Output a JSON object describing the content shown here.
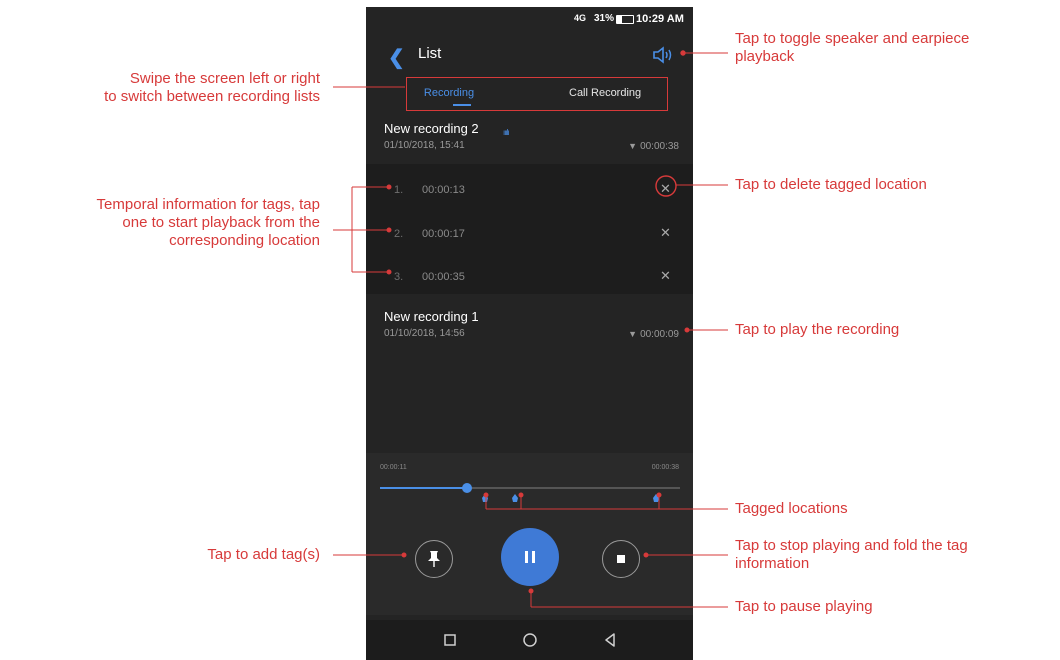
{
  "status_bar": {
    "network": "4G",
    "battery": "31%",
    "time": "10:29 AM"
  },
  "header": {
    "title": "List"
  },
  "tabs": [
    {
      "label": "Recording"
    },
    {
      "label": "Call Recording"
    }
  ],
  "recordings": [
    {
      "title": "New recording 2",
      "date": "01/10/2018, 15:41",
      "duration": "00:00:38",
      "tags": [
        {
          "num": "1.",
          "time": "00:00:13"
        },
        {
          "num": "2.",
          "time": "00:00:17"
        },
        {
          "num": "3.",
          "time": "00:00:35"
        }
      ]
    },
    {
      "title": "New recording 1",
      "date": "01/10/2018, 14:56",
      "duration": "00:00:09"
    }
  ],
  "player": {
    "elapsed": "00:00:11",
    "total": "00:00:38",
    "progress": 0.29,
    "tag_positions": [
      0.35,
      0.45,
      0.92
    ]
  },
  "annotations": {
    "swipe": [
      "Swipe the screen left or right",
      "to switch between recording lists"
    ],
    "toggle": [
      "Tap to toggle speaker and earpiece",
      "playback"
    ],
    "delete_tag": "Tap to delete tagged location",
    "temporal": [
      "Temporal information for tags, tap",
      "one to start playback from the",
      "corresponding location"
    ],
    "play": "Tap to play the recording",
    "tagged": "Tagged locations",
    "add_tag": "Tap to add tag(s)",
    "stop": [
      "Tap to stop playing and fold the tag",
      "information"
    ],
    "pause": "Tap to pause playing"
  },
  "colors": {
    "accent": "#4a8fe7",
    "annotation": "#d73a3a",
    "background": "#242424"
  }
}
